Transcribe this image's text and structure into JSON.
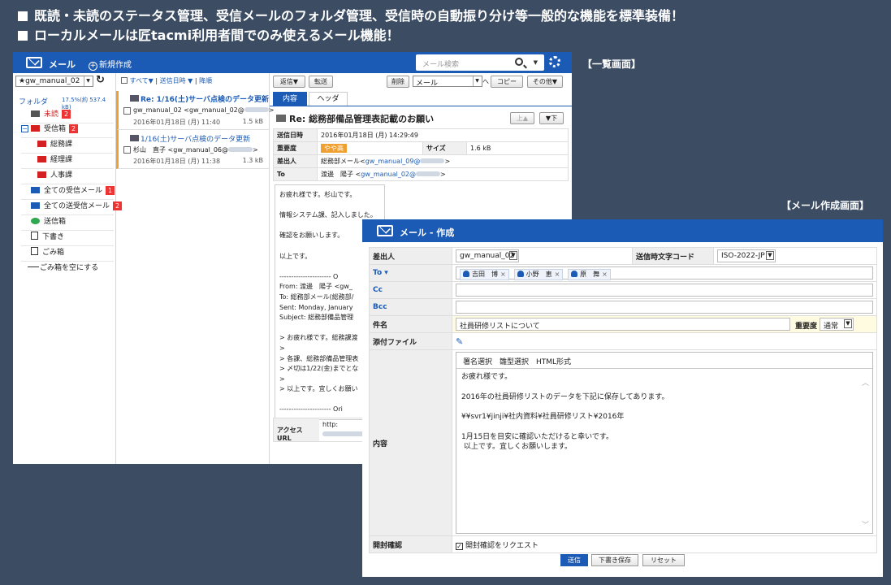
{
  "headline": {
    "line1": "既読・未読のステータス管理、受信メールのフォルダ管理、受信時の自動振り分け等一般的な機能を標準装備！",
    "line2": "ローカルメールは匠tacmi利用者間でのみ使えるメール機能！"
  },
  "captions": {
    "list_view": "【一覧画面】",
    "compose_view": "【メール作成画面】"
  },
  "list_window": {
    "title": "メール",
    "new_label": "新規作成",
    "search_placeholder": "メール検索",
    "account": "★gw_manual_02",
    "folder_heading": "フォルダ",
    "quota": "17.5%(約 537.4 kB)",
    "folders": [
      {
        "label": "未読",
        "count": "2",
        "icon": "envelope-icon"
      },
      {
        "label": "受信箱",
        "count": "2",
        "icon": "folder-icon"
      },
      {
        "label": "総務課",
        "icon": "folder-icon"
      },
      {
        "label": "経理課",
        "icon": "folder-icon"
      },
      {
        "label": "人事課",
        "icon": "folder-icon"
      },
      {
        "label": "全ての受信メール",
        "count": "1",
        "icon": "inbox-all-icon"
      },
      {
        "label": "全ての送受信メール",
        "count": "2",
        "icon": "inbox-all-icon"
      },
      {
        "label": "送信箱",
        "icon": "outbox-icon"
      },
      {
        "label": "下書き",
        "icon": "draft-icon"
      },
      {
        "label": "ごみ箱",
        "icon": "trash-icon"
      },
      {
        "label": "ごみ箱を空にする",
        "icon": "empty-trash-icon"
      }
    ],
    "list_filters": {
      "all": "すべて▼",
      "sort": "送信日時 ▼",
      "desc": "降順"
    },
    "messages": [
      {
        "subject": "Re: 1/16(土)サーバ点検のデータ更新",
        "from": "gw_manual_02 <gw_manual_02@",
        "date": "2016年01月18日 (月) 11:40",
        "size": "1.5 kB"
      },
      {
        "subject": "1/16(土)サーバ点検のデータ更新",
        "from": "杉山　直子 <gw_manual_06@",
        "date": "2016年01月18日 (月) 11:38",
        "size": "1.3 kB"
      }
    ],
    "toolbar": {
      "reply": "返信▼",
      "forward": "転送",
      "delete": "削除",
      "folder_select": "メール",
      "copy": "コピー",
      "other": "その他▼"
    },
    "tabs": {
      "content": "内容",
      "header": "ヘッダ"
    },
    "message": {
      "subject": "Re: 総務部備品管理表記載のお願い",
      "prev": "上▲",
      "next": "▼下",
      "sent_key": "送信日時",
      "sent": "2016年01月18日 (月) 14:29:49",
      "priority_key": "重要度",
      "priority": "やや高",
      "size_key": "サイズ",
      "size": "1.6 kB",
      "from_key": "差出人",
      "from_name": "総務部メール<",
      "from_addr": "gw_manual_09@",
      "to_key": "To",
      "to_name": "渡邊　陽子 <",
      "to_addr": "gw_manual_02@",
      "body": "お疲れ様です。杉山です。\n\n情報システム課、記入しました。\n\n確認をお願いします。\n\n以上です。\n\n---------------------- O\nFrom: 渡邊　陽子 <gw_\nTo: 総務部メール(総務部/\nSent: Monday, January\nSubject: 総務部備品管理\n\n> お疲れ様です。総務課渡\n>\n> 各課、総務部備品管理表\n> 〆切は1/22(金)までとな\n>\n> 以上です。宜しくお願い\n\n---------------------- Ori",
      "access_url_key": "アクセスURL",
      "access_url": "http:"
    }
  },
  "compose_window": {
    "title": "メール - 作成",
    "fields": {
      "from_key": "差出人",
      "from_value": "gw_manual_02",
      "charset_key": "送信時文字コード",
      "charset_value": "ISO-2022-JP",
      "to_key": "To ▾",
      "recipients": [
        "吉田　博",
        "小野　恵",
        "原　舞"
      ],
      "cc_key": "Cc",
      "bcc_key": "Bcc",
      "subject_key": "件名",
      "subject_value": "社員研修リストについて",
      "priority_key": "重要度",
      "priority_value": "通常",
      "attach_key": "添付ファイル",
      "content_key": "内容",
      "editor_tools": "署名選択　雛型選択　HTML形式",
      "body": "お疲れ様です。\n\n2016年の社員研修リストのデータを下記に保存してあります。\n\n¥¥svr1¥jinji¥社内資料¥社員研修リスト¥2016年\n\n1月15日を目安に確認いただけると幸いです。\n 以上です。宜しくお願いします。",
      "read_receipt_key": "開封確認",
      "read_receipt_label": "開封確認をリクエスト"
    },
    "buttons": {
      "send": "送信",
      "save_draft": "下書き保存",
      "reset": "リセット"
    }
  },
  "colors": {
    "background": "#3b4c63",
    "titlebar": "#1c5bb5",
    "badge": "#e33333",
    "priority": "#f0a030"
  }
}
